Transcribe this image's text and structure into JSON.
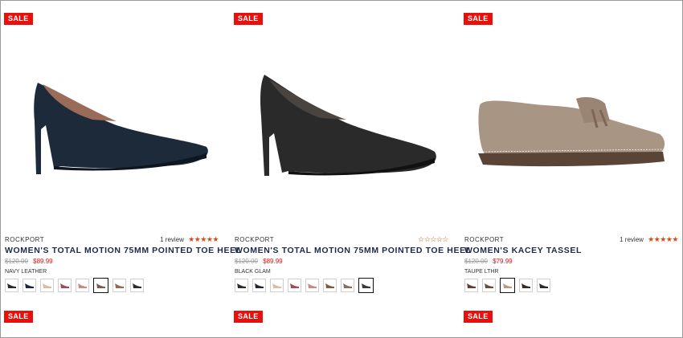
{
  "products": [
    {
      "badge": "SALE",
      "brand": "ROCKPORT",
      "reviews": "1 review",
      "rating_stars": 5,
      "title": "WOMEN'S TOTAL MOTION 75MM POINTED TOE HEEL",
      "old_price": "$120.00",
      "price": "$89.99",
      "color": "NAVY LEATHER",
      "swatches": [
        "#2b2b2b",
        "#1e2636",
        "#d9bca2",
        "#a24a5a",
        "#c58a82",
        "#7a5c4a",
        "#8a6e5a",
        "#2c2c2c"
      ],
      "selected_swatch": 5,
      "next_badge": "SALE"
    },
    {
      "badge": "SALE",
      "brand": "ROCKPORT",
      "reviews": "",
      "rating_stars": 0,
      "title": "WOMEN'S TOTAL MOTION 75MM POINTED TOE HEEL",
      "old_price": "$120.00",
      "price": "$89.99",
      "color": "BLACK GLAM",
      "swatches": [
        "#2b2b2b",
        "#1e2636",
        "#d9bca2",
        "#a24a5a",
        "#c58a82",
        "#7a5c4a",
        "#8a6e5a",
        "#3a3a3a"
      ],
      "selected_swatch": 7,
      "next_badge": "SALE"
    },
    {
      "badge": "SALE",
      "brand": "ROCKPORT",
      "reviews": "1 review",
      "rating_stars": 5,
      "title": "WOMEN'S KACEY TASSEL",
      "old_price": "$120.00",
      "price": "$79.99",
      "color": "TAUPE LTHR",
      "swatches": [
        "#5a4036",
        "#6b4a36",
        "#b89c7a",
        "#3a2a22",
        "#2a2a2a"
      ],
      "selected_swatch": 2,
      "next_badge": "SALE"
    }
  ],
  "colors": {
    "sale": "#e8100c",
    "star": "#e8450c",
    "title": "#1b2a4a"
  }
}
